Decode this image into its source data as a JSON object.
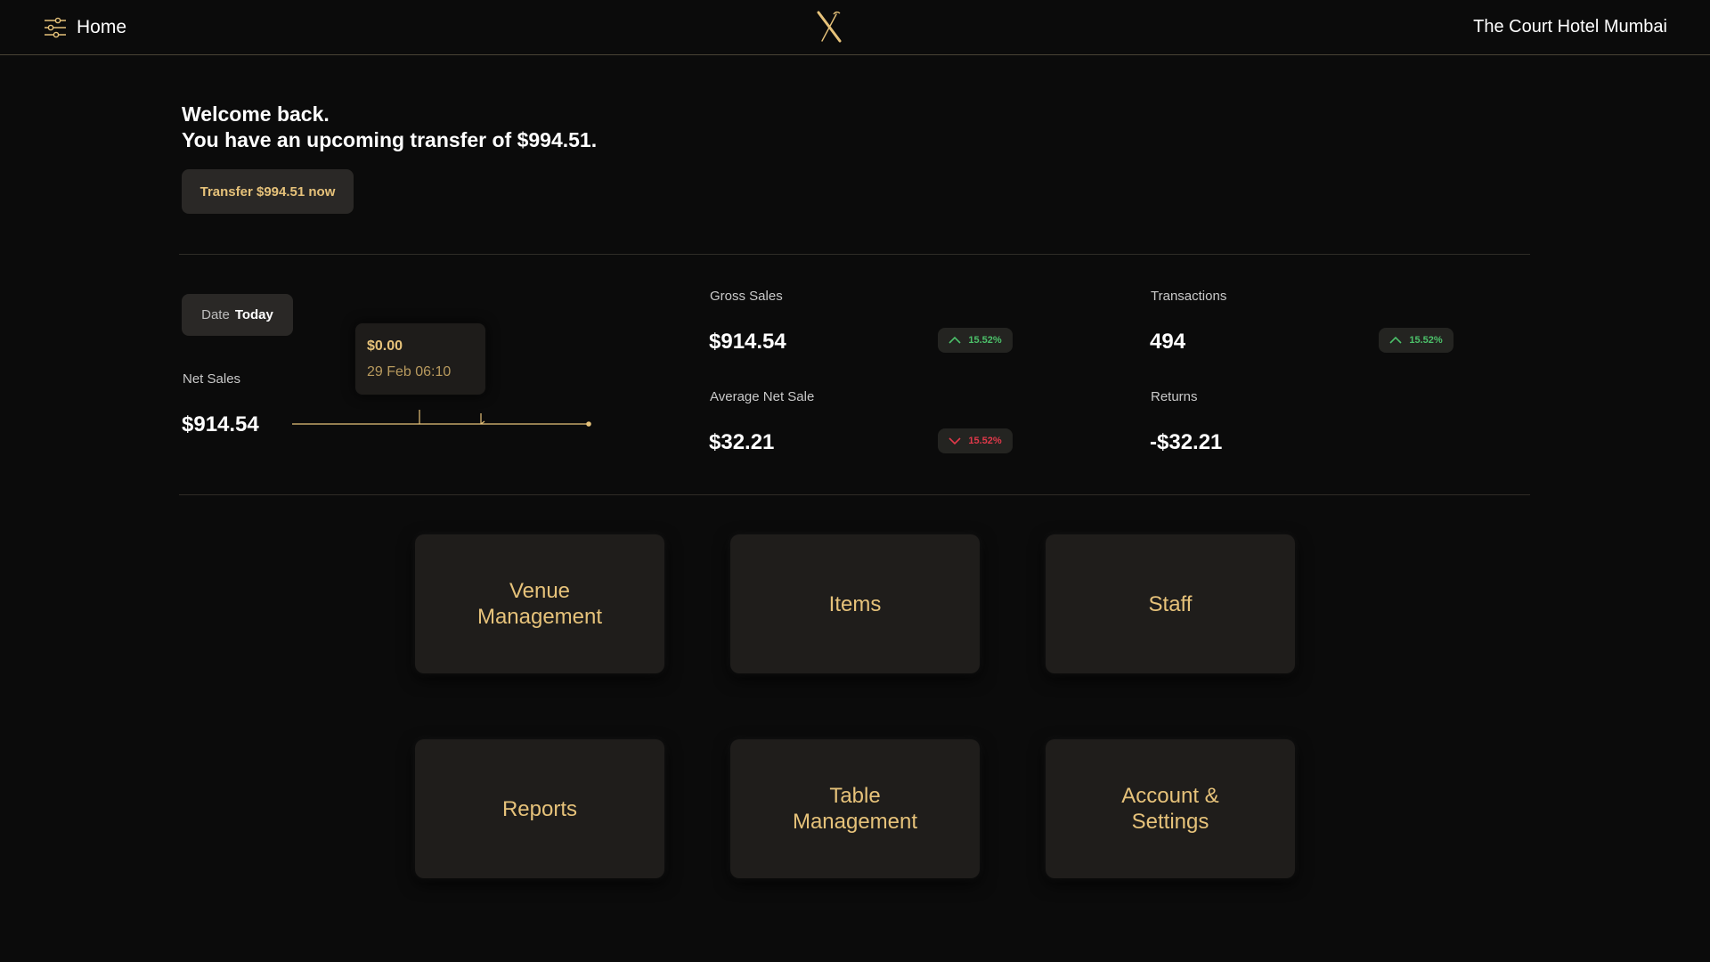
{
  "header": {
    "home_label": "Home",
    "venue_name": "The Court Hotel Mumbai"
  },
  "welcome": {
    "line1": "Welcome back.",
    "line2": "You have an upcoming transfer of $994.51.",
    "transfer_button": "Transfer $994.51 now"
  },
  "date_filter": {
    "label": "Date",
    "value": "Today"
  },
  "net_sales": {
    "label": "Net Sales",
    "value": "$914.54",
    "tooltip_value": "$0.00",
    "tooltip_date": "29 Feb 06:10"
  },
  "metrics": {
    "gross_sales": {
      "label": "Gross Sales",
      "value": "$914.54",
      "change": "15.52%",
      "trend": "up"
    },
    "transactions": {
      "label": "Transactions",
      "value": "494",
      "change": "15.52%",
      "trend": "up"
    },
    "average_net_sale": {
      "label": "Average Net Sale",
      "value": "$32.21",
      "change": "15.52%",
      "trend": "down"
    },
    "returns": {
      "label": "Returns",
      "value": "-$32.21"
    }
  },
  "tiles": [
    {
      "label": "Venue\nManagement"
    },
    {
      "label": "Items"
    },
    {
      "label": "Staff"
    },
    {
      "label": "Reports"
    },
    {
      "label": "Table\nManagement"
    },
    {
      "label": "Account &\nSettings"
    }
  ],
  "colors": {
    "accent_gold": "#e6c27a",
    "background": "#0b0b0b",
    "positive": "#4cc16a",
    "negative": "#e0394a"
  }
}
